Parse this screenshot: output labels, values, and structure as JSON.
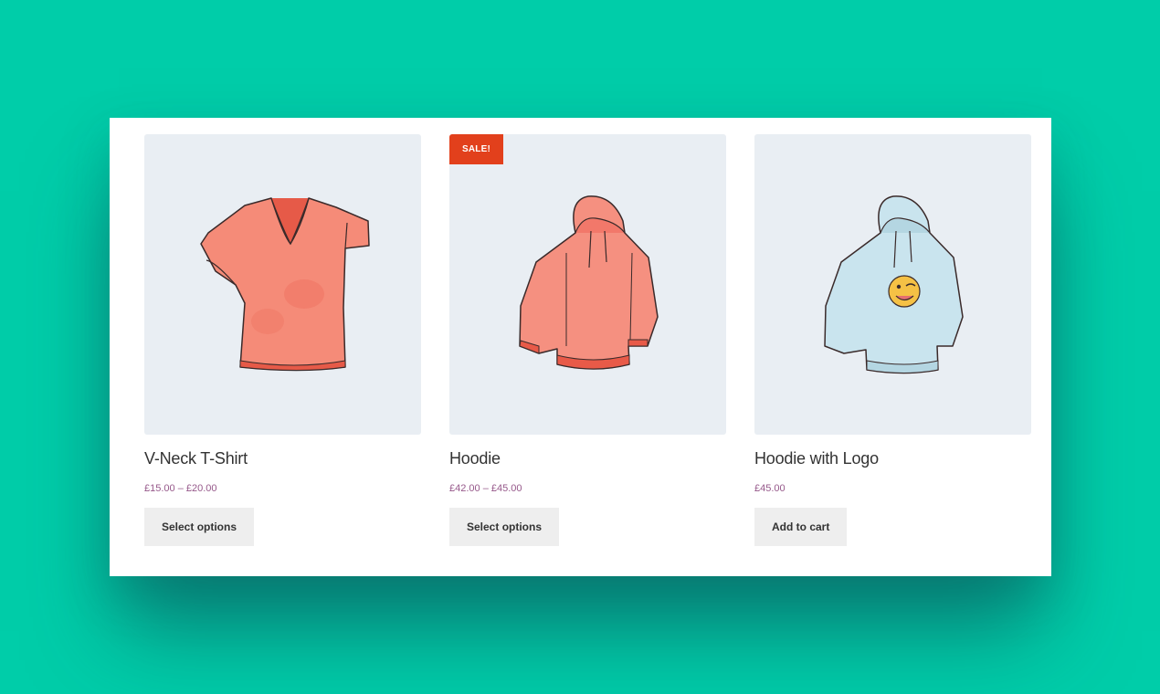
{
  "products": [
    {
      "name": "V-Neck T-Shirt",
      "price": "£15.00 – £20.00",
      "button": "Select options",
      "image_icon": "v-neck-tshirt-illustration",
      "color": "#f58b78"
    },
    {
      "name": "Hoodie",
      "price": "£42.00 – £45.00",
      "button": "Select options",
      "badge": "SALE!",
      "image_icon": "hoodie-illustration",
      "color": "#f59080"
    },
    {
      "name": "Hoodie with Logo",
      "price": "£45.00",
      "button": "Add to cart",
      "image_icon": "hoodie-with-logo-illustration",
      "color": "#c9e4ee"
    }
  ],
  "colors": {
    "background": "#00cda9",
    "sale_badge": "#e2401c",
    "price": "#96588a",
    "button_bg": "#eeeeee"
  }
}
